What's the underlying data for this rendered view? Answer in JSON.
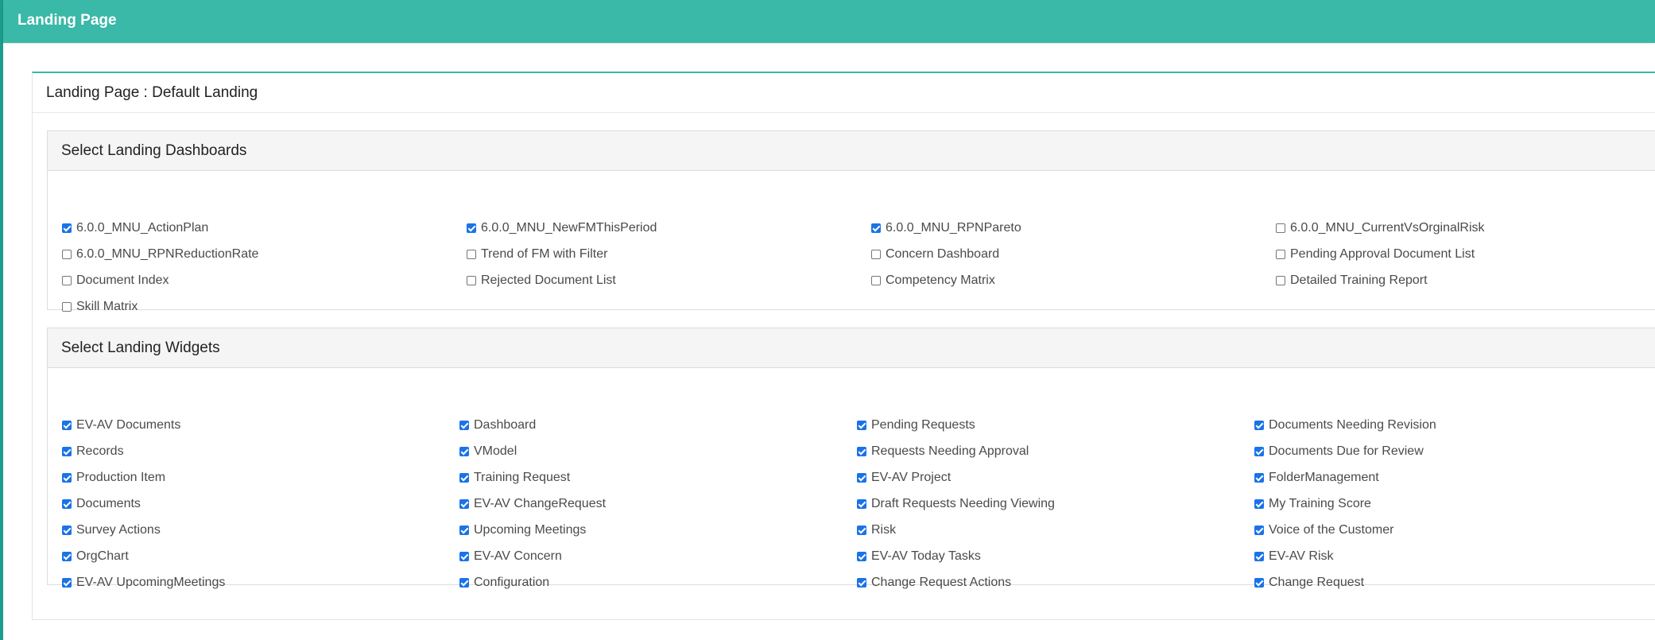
{
  "header": {
    "title": "Landing Page"
  },
  "panel": {
    "title": "Landing Page : Default Landing"
  },
  "dashboards": {
    "title": "Select Landing Dashboards",
    "items": [
      {
        "label": "6.0.0_MNU_ActionPlan",
        "checked": true
      },
      {
        "label": "6.0.0_MNU_NewFMThisPeriod",
        "checked": true
      },
      {
        "label": "6.0.0_MNU_RPNPareto",
        "checked": true
      },
      {
        "label": "6.0.0_MNU_CurrentVsOrginalRisk",
        "checked": false
      },
      {
        "label": "6.0.0_MNU_RPNReductionRate",
        "checked": false
      },
      {
        "label": "Trend of FM with Filter",
        "checked": false
      },
      {
        "label": "Concern Dashboard",
        "checked": false
      },
      {
        "label": "Pending Approval Document List",
        "checked": false
      },
      {
        "label": "Document Index",
        "checked": false
      },
      {
        "label": "Rejected Document List",
        "checked": false
      },
      {
        "label": "Competency Matrix",
        "checked": false
      },
      {
        "label": "Detailed Training Report",
        "checked": false
      },
      {
        "label": "Skill Matrix",
        "checked": false
      }
    ]
  },
  "widgets": {
    "title": "Select Landing Widgets",
    "items": [
      {
        "label": "EV-AV Documents",
        "checked": true
      },
      {
        "label": "Dashboard",
        "checked": true
      },
      {
        "label": "Pending Requests",
        "checked": true
      },
      {
        "label": "Documents Needing Revision",
        "checked": true
      },
      {
        "label": "Records",
        "checked": true
      },
      {
        "label": "VModel",
        "checked": true
      },
      {
        "label": "Requests Needing Approval",
        "checked": true
      },
      {
        "label": "Documents Due for Review",
        "checked": true
      },
      {
        "label": "Production Item",
        "checked": true
      },
      {
        "label": "Training Request",
        "checked": true
      },
      {
        "label": "EV-AV Project",
        "checked": true
      },
      {
        "label": "FolderManagement",
        "checked": true
      },
      {
        "label": "Documents",
        "checked": true
      },
      {
        "label": "EV-AV ChangeRequest",
        "checked": true
      },
      {
        "label": "Draft Requests Needing Viewing",
        "checked": true
      },
      {
        "label": "My Training Score",
        "checked": true
      },
      {
        "label": "Survey Actions",
        "checked": true
      },
      {
        "label": "Upcoming Meetings",
        "checked": true
      },
      {
        "label": "Risk",
        "checked": true
      },
      {
        "label": "Voice of the Customer",
        "checked": true
      },
      {
        "label": "OrgChart",
        "checked": true
      },
      {
        "label": "EV-AV Concern",
        "checked": true
      },
      {
        "label": "EV-AV Today Tasks",
        "checked": true
      },
      {
        "label": "EV-AV Risk",
        "checked": true
      },
      {
        "label": "EV-AV UpcomingMeetings",
        "checked": true
      },
      {
        "label": "Configuration",
        "checked": true
      },
      {
        "label": "Change Request Actions",
        "checked": true
      },
      {
        "label": "Change Request",
        "checked": true
      }
    ]
  },
  "colors": {
    "header": "#3ab8a8",
    "checkbox_checked": "#1a73e8"
  }
}
